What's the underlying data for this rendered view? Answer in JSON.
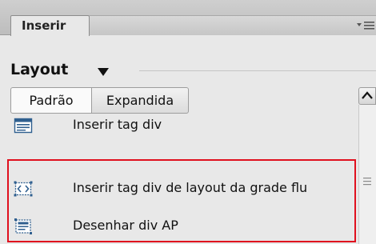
{
  "panel": {
    "tab_label": "Inserir",
    "menu_icon": "panel-options-icon"
  },
  "category": {
    "label": "Layout",
    "dropdown_icon": "triangle-down-icon"
  },
  "view_toggle": {
    "options": [
      "Padrão",
      "Expandida"
    ],
    "selected": "Padrão"
  },
  "items": [
    {
      "label": "Inserir tag div",
      "icon": "div-tag-icon"
    },
    {
      "label": "Inserir tag div de layout da grade flu",
      "icon": "fluid-grid-div-icon"
    },
    {
      "label": "Desenhar div AP",
      "icon": "ap-div-icon"
    }
  ],
  "colors": {
    "highlight": "#e0101e",
    "panel_bg": "#e8e8e8",
    "icon_blue": "#2f5f8f"
  }
}
